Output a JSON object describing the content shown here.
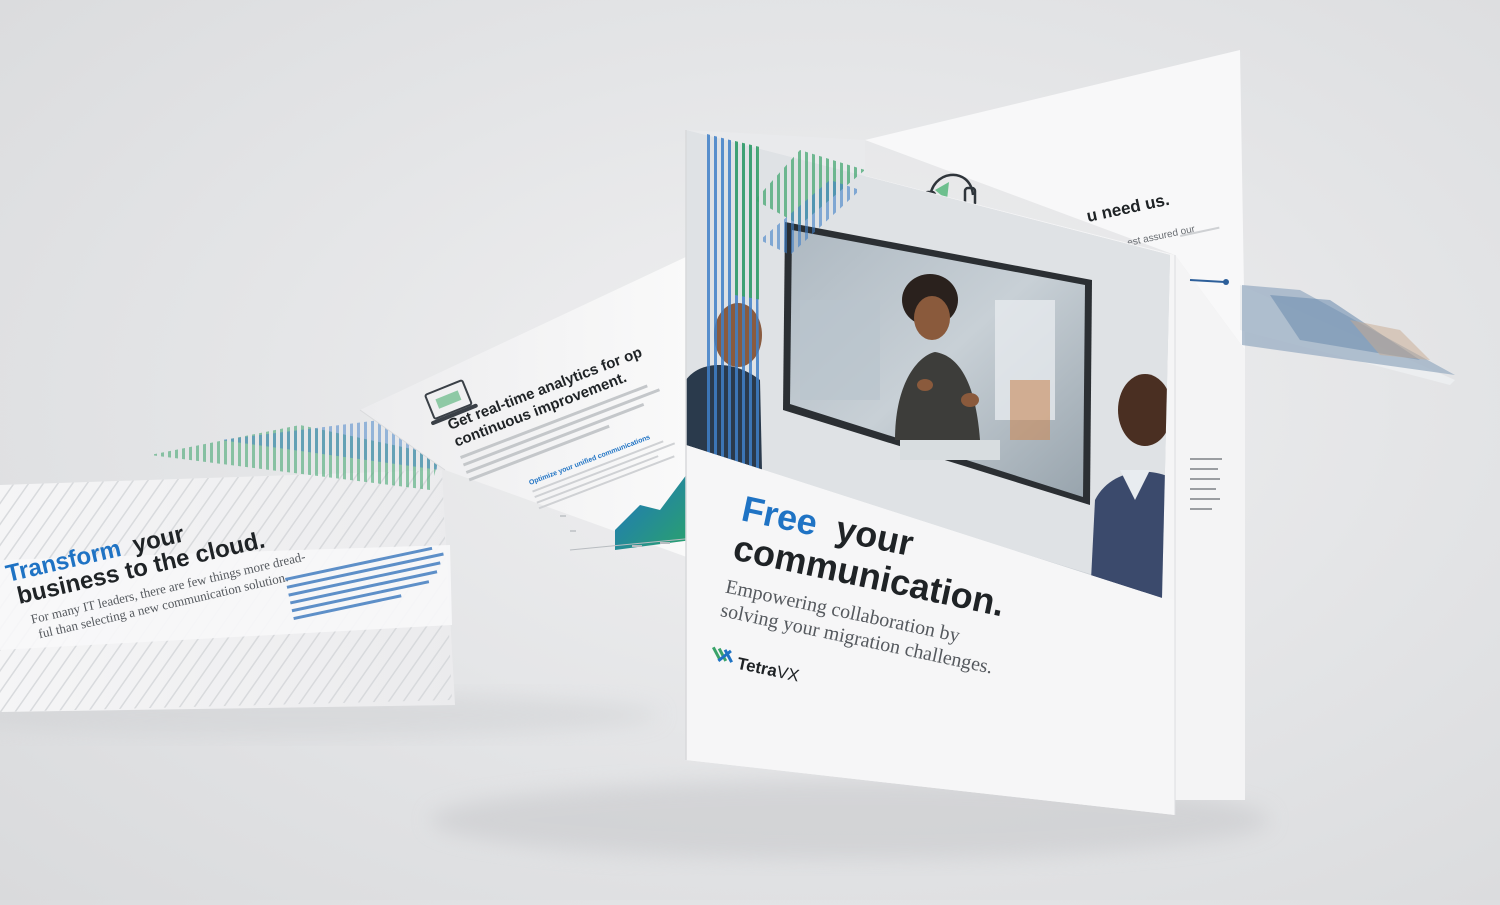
{
  "cover": {
    "headline_accent": "Free",
    "headline_rest_line1": "your",
    "headline_line2": "communication.",
    "subhead_line1": "Empowering collaboration by",
    "subhead_line2": "solving your migration challenges.",
    "brand_name_prefix": "Tetra",
    "brand_name_suffix": "VX"
  },
  "left_panel": {
    "headline_accent": "Transform",
    "headline_rest_line1": "your",
    "headline_line2": "business to the cloud.",
    "body_line1": "For many IT leaders, there are few things more dread-",
    "body_line2": "ful than selecting a new communication solution."
  },
  "middle_panel": {
    "heading_line1": "Get real-time analytics for op",
    "heading_line2": "continuous improvement.",
    "subheading": "Optimize your unified communications"
  },
  "back_panel": {
    "heading_fragment": "u need us.",
    "body_fragment": "est assured our"
  },
  "colors": {
    "accent_blue": "#1f73c4",
    "accent_green": "#3aa36a",
    "text_dark": "#1f2326",
    "text_gray": "#55595e"
  }
}
